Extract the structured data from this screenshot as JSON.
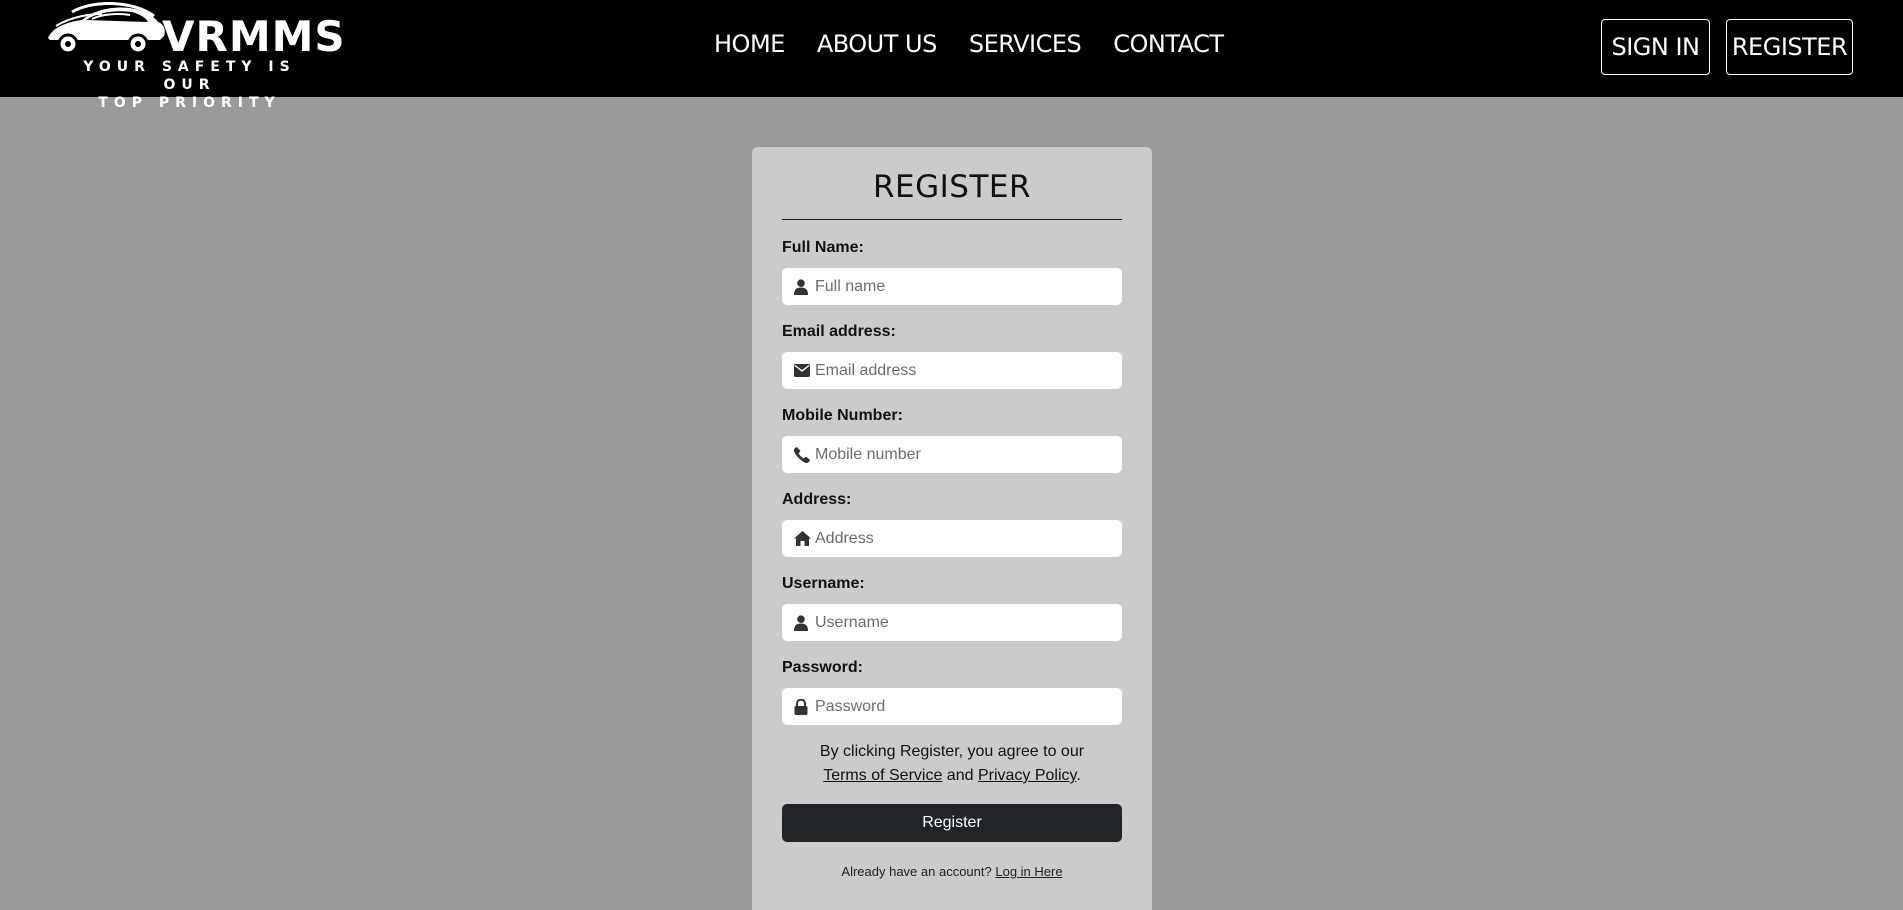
{
  "brand": {
    "name": "VRMMS",
    "tagline_line1": "YOUR SAFETY IS OUR",
    "tagline_line2": "TOP PRIORITY",
    "logo_icon": "car-logo-icon"
  },
  "nav": {
    "items": [
      "HOME",
      "ABOUT US",
      "SERVICES",
      "CONTACT"
    ]
  },
  "auth": {
    "signin_label": "SIGN IN",
    "register_label": "REGISTER"
  },
  "form": {
    "title": "REGISTER",
    "fields": [
      {
        "label": "Full Name:",
        "placeholder": "Full name",
        "icon": "user-icon",
        "value": ""
      },
      {
        "label": "Email address:",
        "placeholder": "Email address",
        "icon": "envelope-icon",
        "value": ""
      },
      {
        "label": "Mobile Number:",
        "placeholder": "Mobile number",
        "icon": "phone-icon",
        "value": ""
      },
      {
        "label": "Address:",
        "placeholder": "Address",
        "icon": "home-icon",
        "value": ""
      },
      {
        "label": "Username:",
        "placeholder": "Username",
        "icon": "user-icon",
        "value": ""
      },
      {
        "label": "Password:",
        "placeholder": "Password",
        "icon": "lock-icon",
        "value": ""
      }
    ],
    "agree_text_1": "By clicking Register, you agree to our",
    "terms_link": "Terms of Service",
    "and_text": "and",
    "privacy_link": "Privacy Policy",
    "period": ".",
    "submit_label": "Register",
    "login_prompt": "Already have an account?",
    "login_link": "Log in Here"
  },
  "colors": {
    "header_bg": "#000000",
    "page_bg": "#999999",
    "card_bg": "#cbcbcb",
    "button_bg": "#212529"
  }
}
